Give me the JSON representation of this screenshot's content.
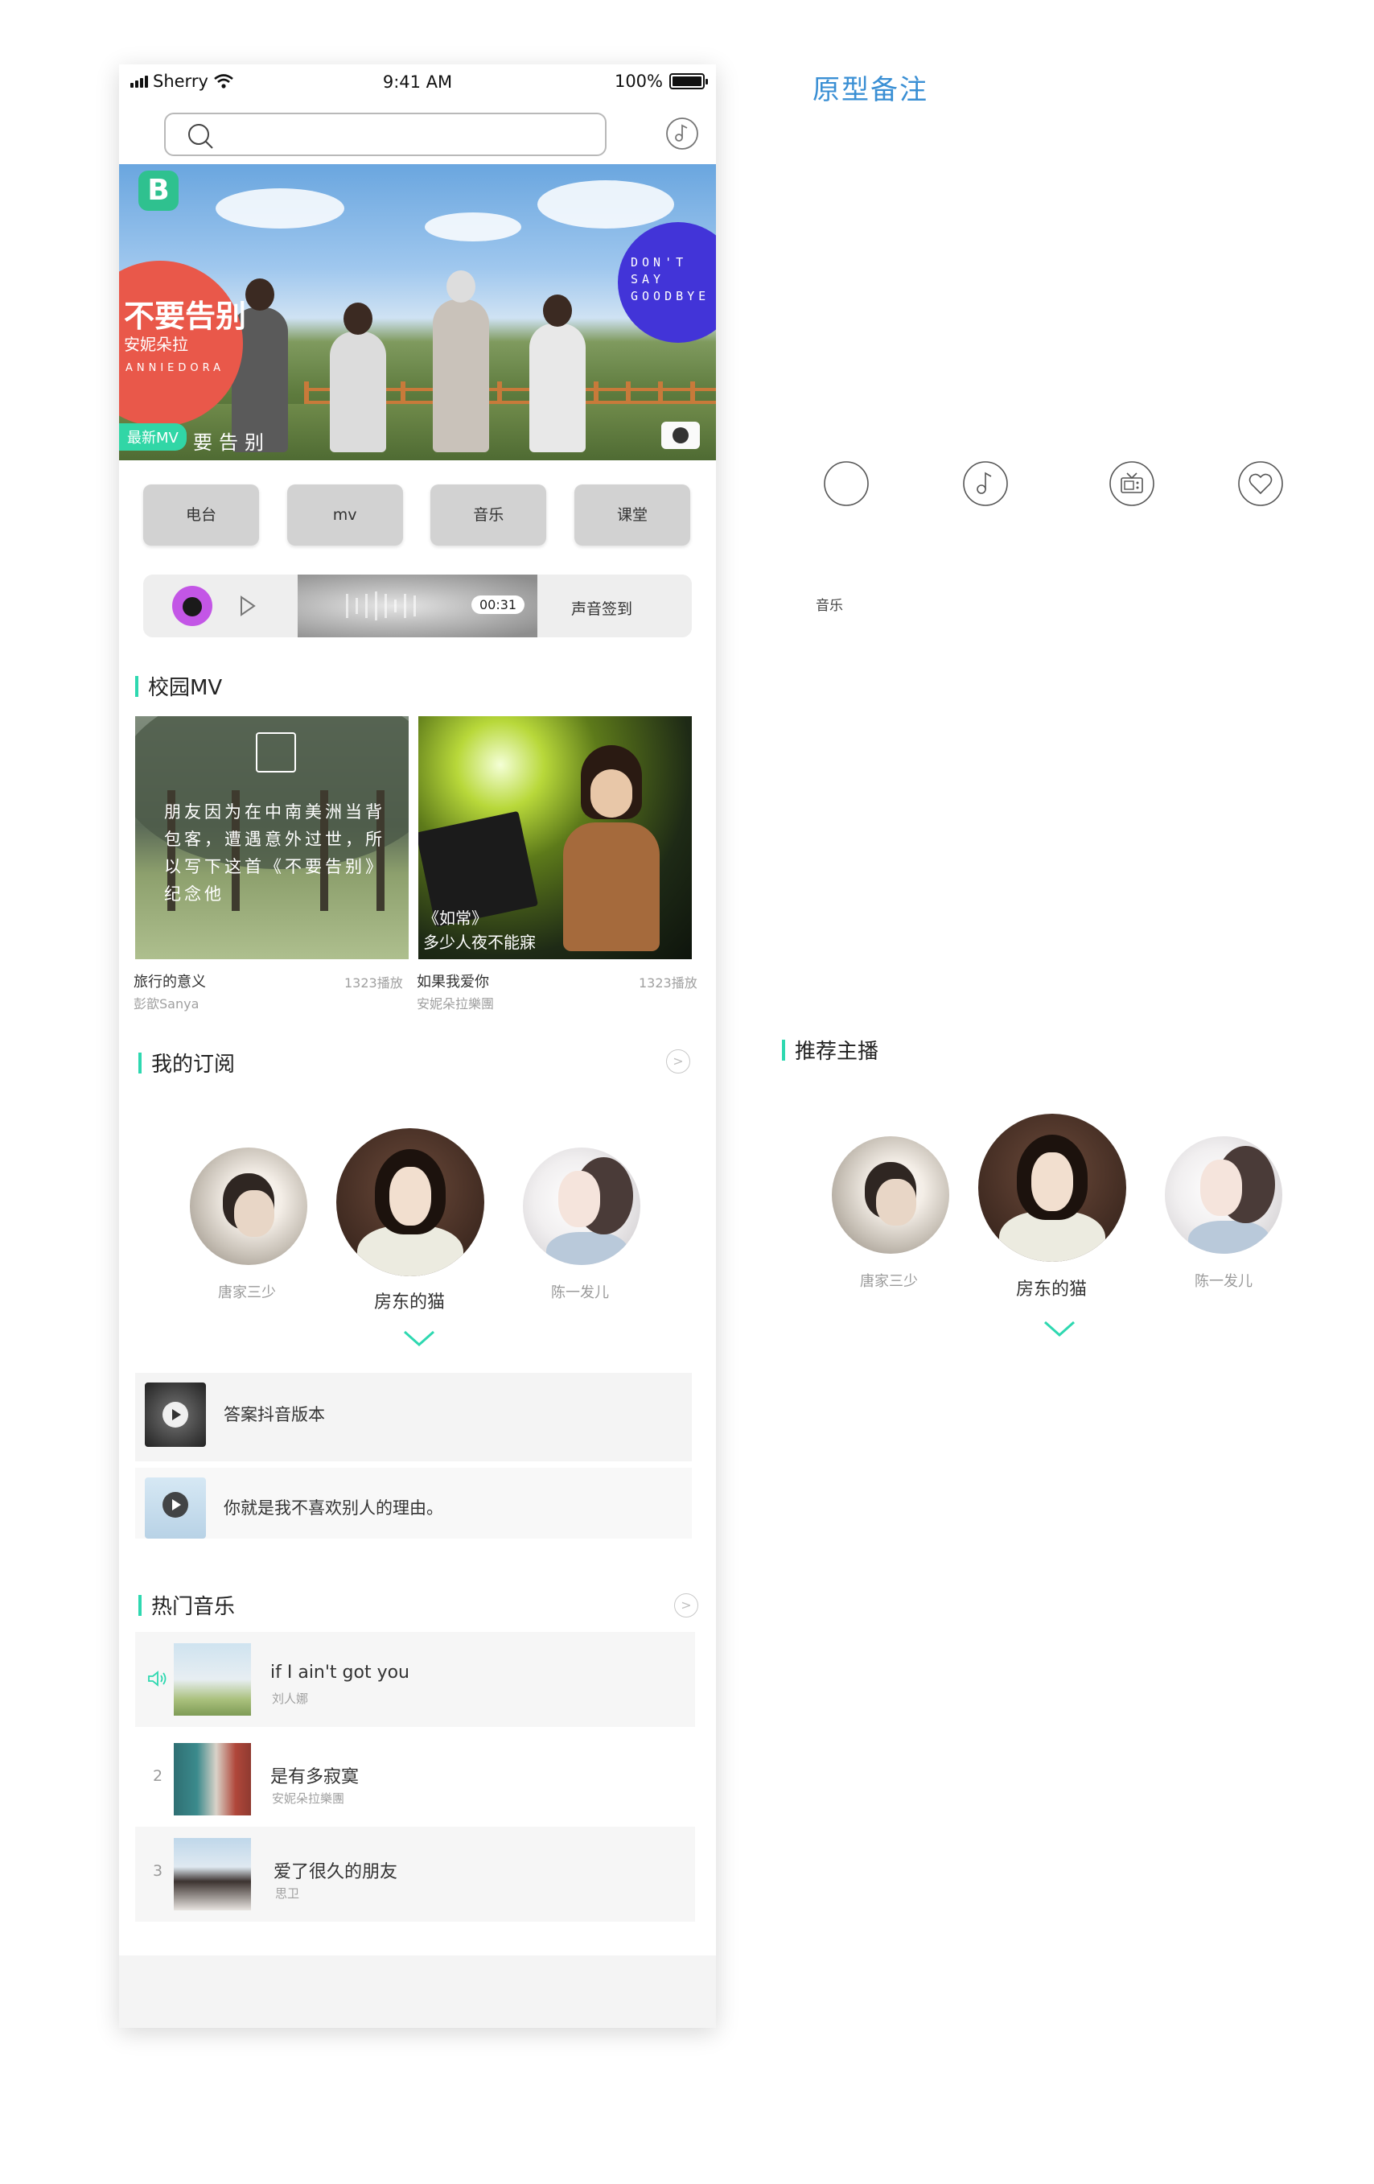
{
  "status_bar": {
    "carrier": "Sherry",
    "time": "9:41 AM",
    "battery": "100%"
  },
  "search": {
    "placeholder": ""
  },
  "banner": {
    "title": "不要告别",
    "artist_cn": "安妮朵拉",
    "artist_en": "ANNIEDORA",
    "badge_en": "DON'T SAY GOODBYE",
    "tag": "最新MV",
    "tag_extra": "要告别",
    "logo_letter": "B"
  },
  "tabs": [
    "电台",
    "mv",
    "音乐",
    "课堂"
  ],
  "voice_checkin": {
    "time": "00:31",
    "label": "声音签到"
  },
  "campus_mv": {
    "title": "校园MV",
    "items": [
      {
        "title": "旅行的意义",
        "author": "彭歆Sanya",
        "plays": "1323播放",
        "poem": "朋友因为在中南美洲当背包客，遭遇意外过世，所以写下这首《不要告别》纪念他"
      },
      {
        "title": "如果我爱你",
        "author": "安妮朵拉樂團",
        "plays": "1323播放",
        "lyric_1": "《如常》",
        "lyric_2": "多少人夜不能寐"
      }
    ]
  },
  "subscriptions": {
    "title": "我的订阅",
    "anchors": [
      {
        "name": "唐家三少"
      },
      {
        "name": "房东的猫"
      },
      {
        "name": "陈一发儿"
      }
    ],
    "items": [
      {
        "title": "答案抖音版本"
      },
      {
        "title": "你就是我不喜欢别人的理由。"
      }
    ]
  },
  "hot_music": {
    "title": "热门音乐",
    "songs": [
      {
        "index": "",
        "title": "if I ain't got you",
        "artist": "刘人娜",
        "playing": true
      },
      {
        "index": "2",
        "title": "是有多寂寞",
        "artist": "安妮朵拉樂團",
        "playing": false
      },
      {
        "index": "3",
        "title": "爱了很久的朋友",
        "artist": "思卫",
        "playing": false
      }
    ]
  },
  "notes": {
    "title": "原型备注",
    "icons": [
      "circle-icon",
      "music-note-icon",
      "tv-icon",
      "heart-icon"
    ],
    "music_label": "音乐",
    "recommend_title": "推荐主播",
    "anchors": [
      {
        "name": "唐家三少"
      },
      {
        "name": "房东的猫"
      },
      {
        "name": "陈一发儿"
      }
    ]
  },
  "colors": {
    "accent": "#2ed8b0",
    "note_blue": "#3a8fd4",
    "banner_red": "#e9584a",
    "banner_purple": "#4234d8"
  }
}
